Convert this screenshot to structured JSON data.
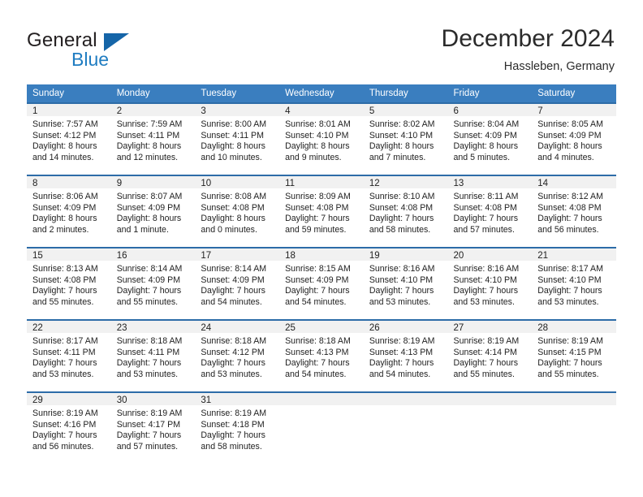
{
  "brand": {
    "name_part1": "General",
    "name_part2": "Blue",
    "logo_icon": "triangle-logo-icon"
  },
  "header": {
    "title": "December 2024",
    "subtitle": "Hassleben, Germany"
  },
  "colors": {
    "header_blue": "#3a7ebf",
    "row_divider_blue": "#2d6ca8",
    "daynum_band": "#f1f1f1",
    "brand_blue": "#1f7cc1",
    "text": "#222222"
  },
  "calendar": {
    "weekday_headers": [
      "Sunday",
      "Monday",
      "Tuesday",
      "Wednesday",
      "Thursday",
      "Friday",
      "Saturday"
    ],
    "weeks": [
      [
        {
          "day": "1",
          "sunrise": "Sunrise: 7:57 AM",
          "sunset": "Sunset: 4:12 PM",
          "daylight1": "Daylight: 8 hours",
          "daylight2": "and 14 minutes."
        },
        {
          "day": "2",
          "sunrise": "Sunrise: 7:59 AM",
          "sunset": "Sunset: 4:11 PM",
          "daylight1": "Daylight: 8 hours",
          "daylight2": "and 12 minutes."
        },
        {
          "day": "3",
          "sunrise": "Sunrise: 8:00 AM",
          "sunset": "Sunset: 4:11 PM",
          "daylight1": "Daylight: 8 hours",
          "daylight2": "and 10 minutes."
        },
        {
          "day": "4",
          "sunrise": "Sunrise: 8:01 AM",
          "sunset": "Sunset: 4:10 PM",
          "daylight1": "Daylight: 8 hours",
          "daylight2": "and 9 minutes."
        },
        {
          "day": "5",
          "sunrise": "Sunrise: 8:02 AM",
          "sunset": "Sunset: 4:10 PM",
          "daylight1": "Daylight: 8 hours",
          "daylight2": "and 7 minutes."
        },
        {
          "day": "6",
          "sunrise": "Sunrise: 8:04 AM",
          "sunset": "Sunset: 4:09 PM",
          "daylight1": "Daylight: 8 hours",
          "daylight2": "and 5 minutes."
        },
        {
          "day": "7",
          "sunrise": "Sunrise: 8:05 AM",
          "sunset": "Sunset: 4:09 PM",
          "daylight1": "Daylight: 8 hours",
          "daylight2": "and 4 minutes."
        }
      ],
      [
        {
          "day": "8",
          "sunrise": "Sunrise: 8:06 AM",
          "sunset": "Sunset: 4:09 PM",
          "daylight1": "Daylight: 8 hours",
          "daylight2": "and 2 minutes."
        },
        {
          "day": "9",
          "sunrise": "Sunrise: 8:07 AM",
          "sunset": "Sunset: 4:09 PM",
          "daylight1": "Daylight: 8 hours",
          "daylight2": "and 1 minute."
        },
        {
          "day": "10",
          "sunrise": "Sunrise: 8:08 AM",
          "sunset": "Sunset: 4:08 PM",
          "daylight1": "Daylight: 8 hours",
          "daylight2": "and 0 minutes."
        },
        {
          "day": "11",
          "sunrise": "Sunrise: 8:09 AM",
          "sunset": "Sunset: 4:08 PM",
          "daylight1": "Daylight: 7 hours",
          "daylight2": "and 59 minutes."
        },
        {
          "day": "12",
          "sunrise": "Sunrise: 8:10 AM",
          "sunset": "Sunset: 4:08 PM",
          "daylight1": "Daylight: 7 hours",
          "daylight2": "and 58 minutes."
        },
        {
          "day": "13",
          "sunrise": "Sunrise: 8:11 AM",
          "sunset": "Sunset: 4:08 PM",
          "daylight1": "Daylight: 7 hours",
          "daylight2": "and 57 minutes."
        },
        {
          "day": "14",
          "sunrise": "Sunrise: 8:12 AM",
          "sunset": "Sunset: 4:08 PM",
          "daylight1": "Daylight: 7 hours",
          "daylight2": "and 56 minutes."
        }
      ],
      [
        {
          "day": "15",
          "sunrise": "Sunrise: 8:13 AM",
          "sunset": "Sunset: 4:08 PM",
          "daylight1": "Daylight: 7 hours",
          "daylight2": "and 55 minutes."
        },
        {
          "day": "16",
          "sunrise": "Sunrise: 8:14 AM",
          "sunset": "Sunset: 4:09 PM",
          "daylight1": "Daylight: 7 hours",
          "daylight2": "and 55 minutes."
        },
        {
          "day": "17",
          "sunrise": "Sunrise: 8:14 AM",
          "sunset": "Sunset: 4:09 PM",
          "daylight1": "Daylight: 7 hours",
          "daylight2": "and 54 minutes."
        },
        {
          "day": "18",
          "sunrise": "Sunrise: 8:15 AM",
          "sunset": "Sunset: 4:09 PM",
          "daylight1": "Daylight: 7 hours",
          "daylight2": "and 54 minutes."
        },
        {
          "day": "19",
          "sunrise": "Sunrise: 8:16 AM",
          "sunset": "Sunset: 4:10 PM",
          "daylight1": "Daylight: 7 hours",
          "daylight2": "and 53 minutes."
        },
        {
          "day": "20",
          "sunrise": "Sunrise: 8:16 AM",
          "sunset": "Sunset: 4:10 PM",
          "daylight1": "Daylight: 7 hours",
          "daylight2": "and 53 minutes."
        },
        {
          "day": "21",
          "sunrise": "Sunrise: 8:17 AM",
          "sunset": "Sunset: 4:10 PM",
          "daylight1": "Daylight: 7 hours",
          "daylight2": "and 53 minutes."
        }
      ],
      [
        {
          "day": "22",
          "sunrise": "Sunrise: 8:17 AM",
          "sunset": "Sunset: 4:11 PM",
          "daylight1": "Daylight: 7 hours",
          "daylight2": "and 53 minutes."
        },
        {
          "day": "23",
          "sunrise": "Sunrise: 8:18 AM",
          "sunset": "Sunset: 4:11 PM",
          "daylight1": "Daylight: 7 hours",
          "daylight2": "and 53 minutes."
        },
        {
          "day": "24",
          "sunrise": "Sunrise: 8:18 AM",
          "sunset": "Sunset: 4:12 PM",
          "daylight1": "Daylight: 7 hours",
          "daylight2": "and 53 minutes."
        },
        {
          "day": "25",
          "sunrise": "Sunrise: 8:18 AM",
          "sunset": "Sunset: 4:13 PM",
          "daylight1": "Daylight: 7 hours",
          "daylight2": "and 54 minutes."
        },
        {
          "day": "26",
          "sunrise": "Sunrise: 8:19 AM",
          "sunset": "Sunset: 4:13 PM",
          "daylight1": "Daylight: 7 hours",
          "daylight2": "and 54 minutes."
        },
        {
          "day": "27",
          "sunrise": "Sunrise: 8:19 AM",
          "sunset": "Sunset: 4:14 PM",
          "daylight1": "Daylight: 7 hours",
          "daylight2": "and 55 minutes."
        },
        {
          "day": "28",
          "sunrise": "Sunrise: 8:19 AM",
          "sunset": "Sunset: 4:15 PM",
          "daylight1": "Daylight: 7 hours",
          "daylight2": "and 55 minutes."
        }
      ],
      [
        {
          "day": "29",
          "sunrise": "Sunrise: 8:19 AM",
          "sunset": "Sunset: 4:16 PM",
          "daylight1": "Daylight: 7 hours",
          "daylight2": "and 56 minutes."
        },
        {
          "day": "30",
          "sunrise": "Sunrise: 8:19 AM",
          "sunset": "Sunset: 4:17 PM",
          "daylight1": "Daylight: 7 hours",
          "daylight2": "and 57 minutes."
        },
        {
          "day": "31",
          "sunrise": "Sunrise: 8:19 AM",
          "sunset": "Sunset: 4:18 PM",
          "daylight1": "Daylight: 7 hours",
          "daylight2": "and 58 minutes."
        },
        {
          "day": "",
          "sunrise": "",
          "sunset": "",
          "daylight1": "",
          "daylight2": ""
        },
        {
          "day": "",
          "sunrise": "",
          "sunset": "",
          "daylight1": "",
          "daylight2": ""
        },
        {
          "day": "",
          "sunrise": "",
          "sunset": "",
          "daylight1": "",
          "daylight2": ""
        },
        {
          "day": "",
          "sunrise": "",
          "sunset": "",
          "daylight1": "",
          "daylight2": ""
        }
      ]
    ]
  }
}
